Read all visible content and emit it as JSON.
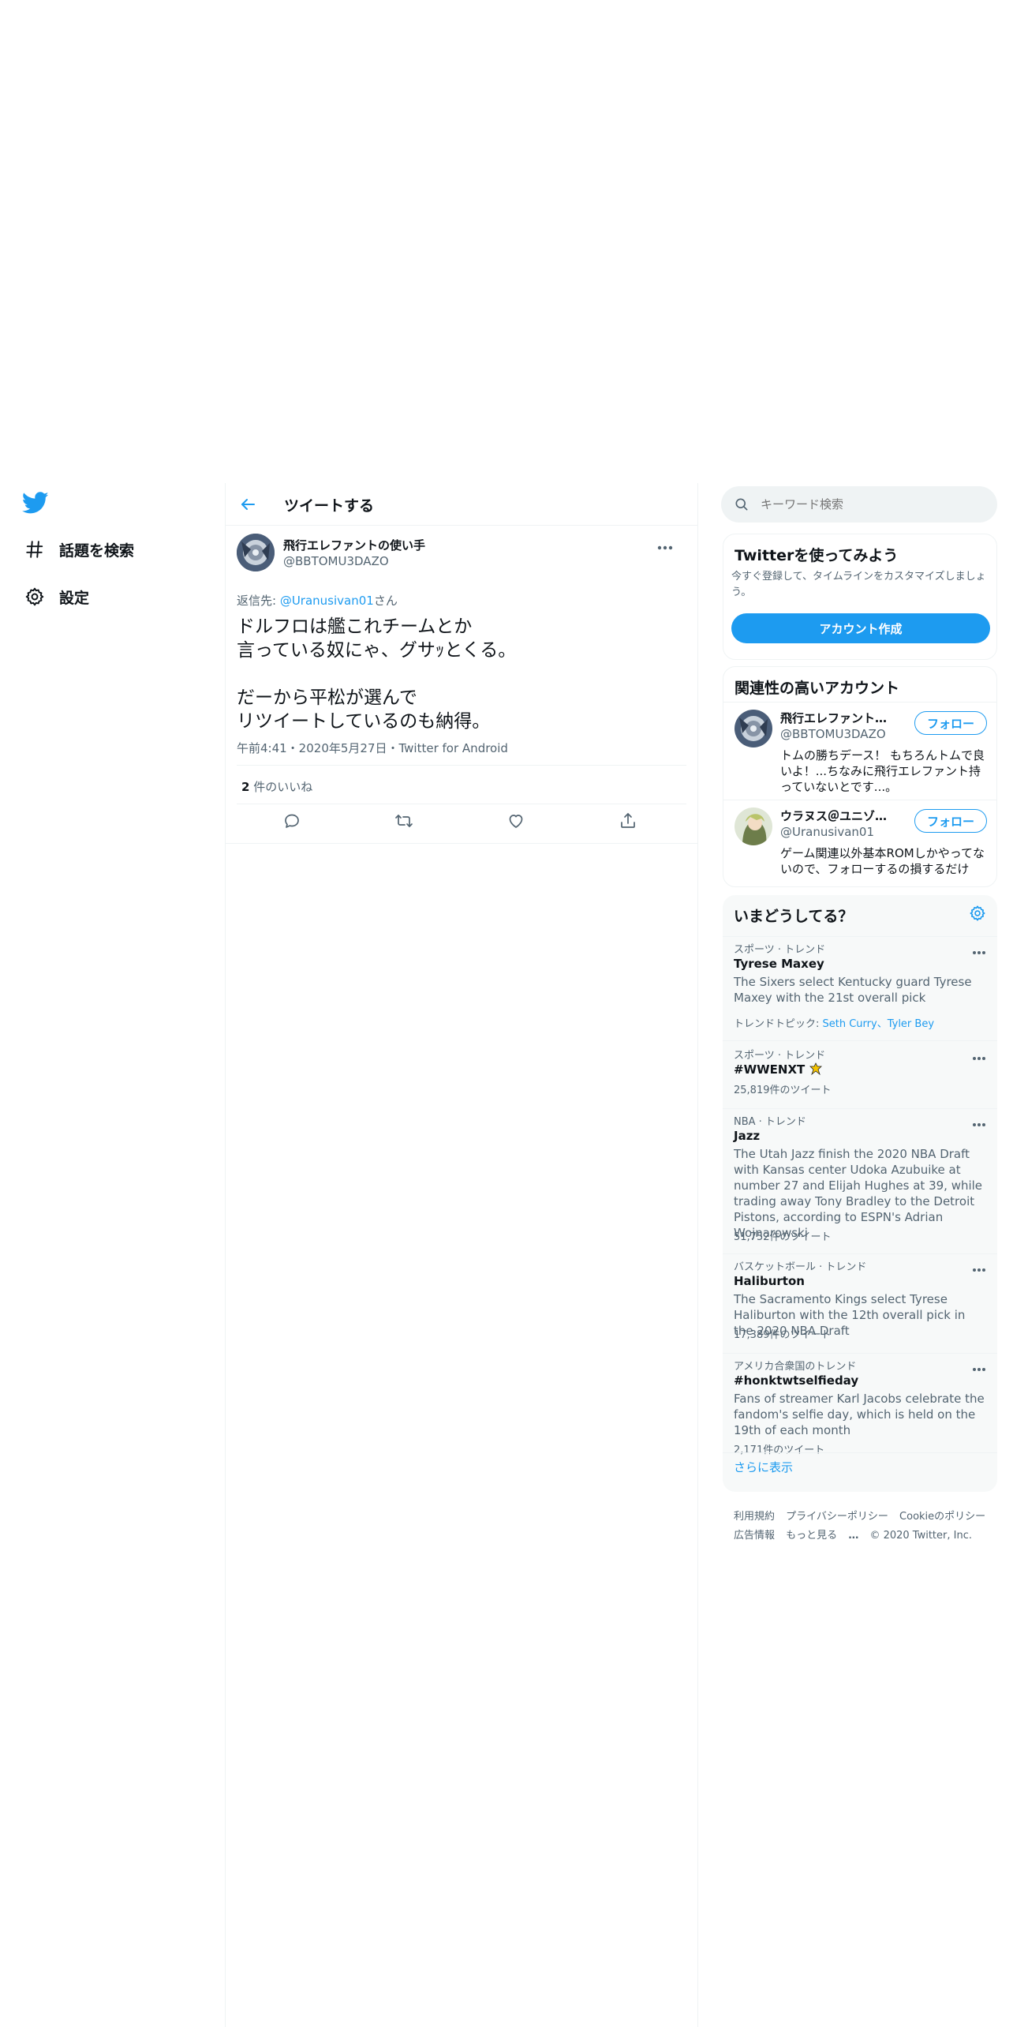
{
  "nav": {
    "explore_label": "話題を検索",
    "settings_label": "設定"
  },
  "header": {
    "title": "ツイートする"
  },
  "tweet": {
    "author_name": "飛行エレファントの使い手",
    "author_handle": "@BBTOMU3DAZO",
    "reply_prefix": "返信先: ",
    "reply_mention": "@Uranusivan01",
    "reply_suffix": "さん",
    "text": "ドルフロは艦これチームとか\n言っている奴にゃ、グサｯとくる。\n\nだーから平松が選んで\nリツイートしているのも納得。",
    "meta": "午前4:41・2020年5月27日・Twitter for Android",
    "likes_count": "2",
    "likes_label": " 件のいいね"
  },
  "search": {
    "placeholder": "キーワード検索"
  },
  "signup": {
    "title": "Twitterを使ってみよう",
    "description": "今すぐ登録して、タイムラインをカスタマイズしましょう。",
    "button_label": "アカウント作成"
  },
  "related": {
    "title": "関連性の高いアカウント",
    "accounts": [
      {
        "name": "飛行エレファントの使い手",
        "handle": "@BBTOMU3DAZO",
        "bio": "トムの勝ちデース！ もちろんトムで良いよ！...ちなみに飛行エレファント持っていないとです...。",
        "follow_label": "フォロー"
      },
      {
        "name": "ウラヌス＠ユニゾンエアー",
        "handle": "@Uranusivan01",
        "bio": "ゲーム関連以外基本ROMしかやってないので、フォローするの損するだけ",
        "follow_label": "フォロー"
      }
    ]
  },
  "trends": {
    "title": "いまどうしてる？",
    "items": [
      {
        "context": "スポーツ · トレンド",
        "name": "Tyrese Maxey",
        "description": "The Sixers select Kentucky guard Tyrese Maxey with the 21st overall pick",
        "topics_label": "トレンドトピック: ",
        "topics": "Seth Curry、Tyler Bey"
      },
      {
        "context": "スポーツ · トレンド",
        "name": "#WWENXT",
        "count": "25,819件のツイート"
      },
      {
        "context": "NBA · トレンド",
        "name": "Jazz",
        "description": "The Utah Jazz finish the 2020 NBA Draft with Kansas center Udoka Azubuike at number 27 and Elijah Hughes at 39, while trading away Tony Bradley to the Detroit Pistons, according to ESPN's Adrian Wojnarowski",
        "count": "51,752件のツイート"
      },
      {
        "context": "バスケットボール · トレンド",
        "name": "Haliburton",
        "description": "The Sacramento Kings select Tyrese Haliburton with the 12th overall pick in the 2020 NBA Draft",
        "count": "17,389件のツイート"
      },
      {
        "context": "アメリカ合衆国のトレンド",
        "name": "#honktwtselfieday",
        "description": "Fans of streamer Karl Jacobs celebrate the fandom's selfie day, which is held on the 19th of each month",
        "count": "2,171件のツイート"
      }
    ],
    "show_more": "さらに表示"
  },
  "footer": {
    "terms": "利用規約",
    "privacy": "プライバシーポリシー",
    "cookies": "Cookieのポリシー",
    "ads": "広告情報",
    "more": "もっと見る",
    "copyright": "© 2020 Twitter, Inc."
  },
  "colors": {
    "accent": "#1d9bf0",
    "text": "#0f1419",
    "secondary": "#536471",
    "border": "#eff3f4"
  }
}
